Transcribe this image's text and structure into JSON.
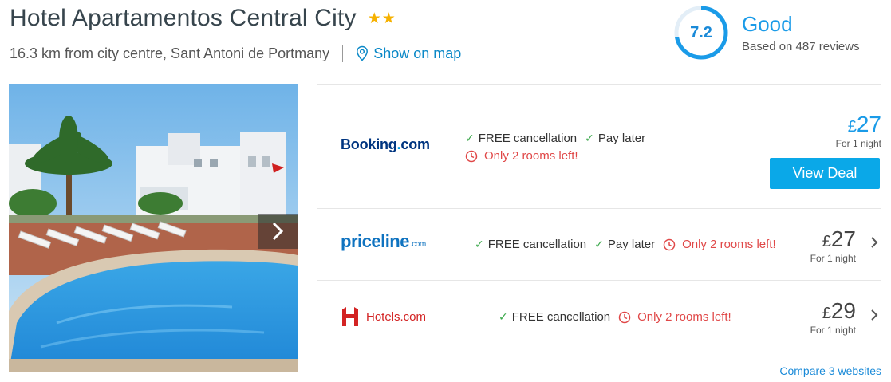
{
  "hotel": {
    "name": "Hotel Apartamentos Central City",
    "star_count": 2,
    "star_icon": "star-icon",
    "distance_text": "16.3 km from city centre, Sant Antoni de Portmany",
    "map_link": "Show on map"
  },
  "rating": {
    "score": "7.2",
    "score_fraction": 0.72,
    "label": "Good",
    "reviews": "Based on 487 reviews"
  },
  "colors": {
    "accent": "#1a9be8",
    "deal_button": "#0aa8e8",
    "check": "#3aa84a",
    "warning": "#e04848",
    "star": "#f6b100"
  },
  "deals": [
    {
      "provider": "Booking.com",
      "provider_parts": [
        "Booking",
        ".",
        "com"
      ],
      "features": [
        "FREE cancellation",
        "Pay later"
      ],
      "warning": "Only 2 rooms left!",
      "price_currency": "£",
      "price_value": "27",
      "per_night": "For 1 night",
      "button": "View Deal"
    },
    {
      "provider": "priceline.com",
      "provider_parts": [
        "priceline",
        ".com"
      ],
      "features": [
        "FREE cancellation",
        "Pay later"
      ],
      "warning": "Only 2 rooms left!",
      "price_currency": "£",
      "price_value": "27",
      "per_night": "For 1 night"
    },
    {
      "provider": "Hotels.com",
      "features": [
        "FREE cancellation"
      ],
      "warning": "Only 2 rooms left!",
      "price_currency": "£",
      "price_value": "29",
      "per_night": "For 1 night"
    }
  ],
  "compare_link": "Compare 3 websites",
  "icons": {
    "map_pin": "map-pin-icon",
    "check": "check-icon",
    "clock": "clock-icon",
    "next": "chevron-right-icon"
  }
}
